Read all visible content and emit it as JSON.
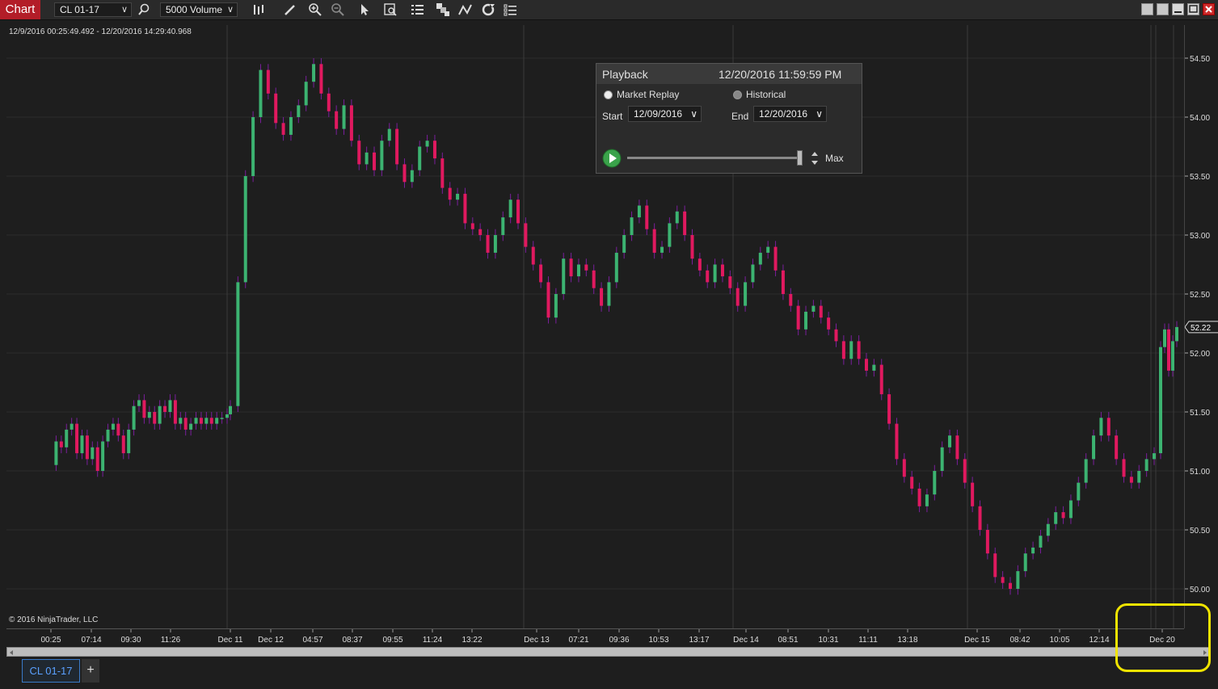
{
  "toolbar": {
    "chart_label": "Chart",
    "instrument": "CL 01-17",
    "period": "5000 Volume"
  },
  "chart": {
    "range_text": "12/9/2016 00:25:49.492 - 12/20/2016 14:29:40.968",
    "copyright": "© 2016 NinjaTrader, LLC",
    "last_price": "52.22",
    "price_up_color": "#3cb371",
    "price_down_color": "#e0195f"
  },
  "playback": {
    "title": "Playback",
    "datetime": "12/20/2016 11:59:59 PM",
    "market_replay_label": "Market Replay",
    "historical_label": "Historical",
    "start_label": "Start",
    "start_value": "12/09/2016",
    "end_label": "End",
    "end_value": "12/20/2016",
    "speed_label": "Max"
  },
  "tabs": {
    "active": "CL 01-17",
    "add": "+"
  },
  "chart_data": {
    "type": "candlestick",
    "title": "",
    "ylim": [
      49.8,
      54.7
    ],
    "y_ticks": [
      "54.50",
      "54.00",
      "53.50",
      "53.00",
      "52.50",
      "52.00",
      "51.50",
      "51.00",
      "50.50",
      "50.00"
    ],
    "x_ticks": [
      "00:25",
      "07:14",
      "09:30",
      "11:26",
      "Dec 11",
      "Dec 12",
      "04:57",
      "08:37",
      "09:55",
      "11:24",
      "13:22",
      "Dec 13",
      "07:21",
      "09:36",
      "10:53",
      "13:17",
      "Dec 14",
      "08:51",
      "10:31",
      "11:11",
      "13:18",
      "Dec 15",
      "08:42",
      "10:05",
      "12:14",
      "Dec 20"
    ],
    "series": [
      {
        "name": "CL 01-17",
        "values": [
          51.05,
          51.25,
          51.2,
          51.35,
          51.4,
          51.15,
          51.3,
          51.1,
          51.2,
          51.0,
          51.25,
          51.35,
          51.4,
          51.3,
          51.15,
          51.35,
          51.55,
          51.6,
          51.45,
          51.5,
          51.4,
          51.55,
          51.5,
          51.6,
          51.4,
          51.45,
          51.35,
          51.4,
          51.45,
          51.4,
          51.45,
          51.4,
          51.45,
          51.45,
          51.48,
          51.55,
          52.6,
          53.5,
          54.0,
          54.4,
          54.2,
          53.95,
          53.85,
          54.0,
          54.1,
          54.3,
          54.45,
          54.2,
          54.05,
          53.9,
          54.1,
          53.8,
          53.6,
          53.7,
          53.55,
          53.8,
          53.9,
          53.6,
          53.45,
          53.55,
          53.75,
          53.8,
          53.65,
          53.4,
          53.3,
          53.35,
          53.1,
          53.05,
          53.0,
          52.85,
          53.0,
          53.15,
          53.3,
          53.1,
          52.9,
          52.75,
          52.6,
          52.3,
          52.5,
          52.8,
          52.65,
          52.75,
          52.7,
          52.55,
          52.4,
          52.6,
          52.85,
          53.0,
          53.15,
          53.25,
          53.05,
          52.85,
          52.9,
          53.1,
          53.2,
          53.0,
          52.8,
          52.7,
          52.6,
          52.75,
          52.65,
          52.55,
          52.4,
          52.6,
          52.75,
          52.85,
          52.9,
          52.7,
          52.5,
          52.4,
          52.2,
          52.35,
          52.4,
          52.3,
          52.2,
          52.1,
          51.95,
          52.1,
          51.95,
          51.85,
          51.9,
          51.65,
          51.4,
          51.1,
          50.95,
          50.85,
          50.7,
          50.8,
          51.0,
          51.2,
          51.3,
          51.1,
          50.9,
          50.7,
          50.5,
          50.3,
          50.1,
          50.05,
          50.0,
          50.15,
          50.3,
          50.35,
          50.45,
          50.55,
          50.65,
          50.6,
          50.75,
          50.9,
          51.1,
          51.3,
          51.45,
          51.3,
          51.1,
          50.95,
          50.9,
          51.0,
          51.1,
          51.15,
          52.05,
          52.2,
          51.85,
          52.1,
          52.22
        ]
      }
    ]
  }
}
